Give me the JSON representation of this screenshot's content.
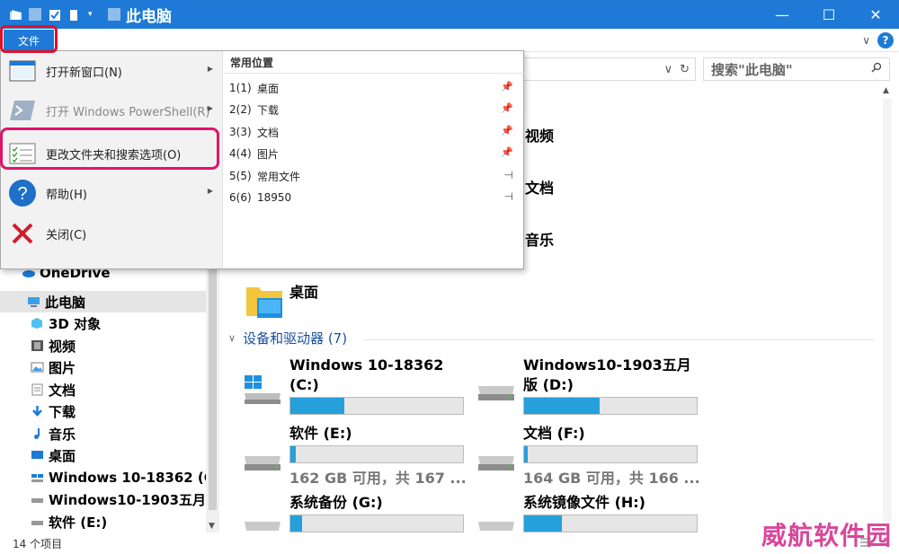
{
  "window": {
    "title": "此电脑",
    "minimize": "—",
    "maximize": "☐",
    "close": "✕"
  },
  "ribbon": {
    "file_tab": "文件",
    "collapse_arrow": "∨",
    "help": "?"
  },
  "address": {
    "dropdown_arrow": "∨",
    "refresh_glyph": "↻"
  },
  "search": {
    "placeholder": "搜索\"此电脑\"",
    "icon": "search-icon"
  },
  "file_menu": {
    "items": [
      {
        "label": "打开新窗口(N)",
        "icon": "new-window-icon",
        "has_submenu": true,
        "enabled": true
      },
      {
        "label": "打开 Windows PowerShell(R)",
        "icon": "powershell-icon",
        "has_submenu": true,
        "enabled": false
      },
      {
        "label": "更改文件夹和搜索选项(O)",
        "icon": "folder-options-icon",
        "has_submenu": false,
        "enabled": true
      },
      {
        "label": "帮助(H)",
        "icon": "help-icon",
        "has_submenu": true,
        "enabled": true
      },
      {
        "label": "关闭(C)",
        "icon": "close-x-icon",
        "has_submenu": false,
        "enabled": true
      }
    ],
    "recent_header": "常用位置",
    "recent": [
      {
        "index": "1(1)",
        "name": "桌面",
        "pinned": true
      },
      {
        "index": "2(2)",
        "name": "下载",
        "pinned": true
      },
      {
        "index": "3(3)",
        "name": "文档",
        "pinned": true
      },
      {
        "index": "4(4)",
        "name": "图片",
        "pinned": true
      },
      {
        "index": "5(5)",
        "name": "常用文件",
        "pinned": false
      },
      {
        "index": "6(6)",
        "name": "18950",
        "pinned": false
      }
    ]
  },
  "nav": {
    "items": [
      {
        "label": "OneDrive",
        "icon": "onedrive-icon"
      },
      {
        "label": "此电脑",
        "icon": "this-pc-icon",
        "selected": true
      },
      {
        "label": "3D 对象",
        "icon": "3d-objects-icon"
      },
      {
        "label": "视频",
        "icon": "videos-icon"
      },
      {
        "label": "图片",
        "icon": "pictures-icon"
      },
      {
        "label": "文档",
        "icon": "documents-icon"
      },
      {
        "label": "下载",
        "icon": "downloads-icon"
      },
      {
        "label": "音乐",
        "icon": "music-icon"
      },
      {
        "label": "桌面",
        "icon": "desktop-icon"
      },
      {
        "label": "Windows 10-18362 (C",
        "icon": "os-drive-icon"
      },
      {
        "label": "Windows10-1903五月",
        "icon": "drive-icon"
      },
      {
        "label": "软件 (E:)",
        "icon": "drive-icon"
      }
    ]
  },
  "folders": [
    {
      "label": "视频",
      "icon": "videos-folder-icon"
    },
    {
      "label": "文档",
      "icon": "documents-folder-icon"
    },
    {
      "label": "音乐",
      "icon": "music-folder-icon"
    },
    {
      "label": "桌面",
      "icon": "desktop-folder-icon"
    }
  ],
  "devices_header": "设备和驱动器 (7)",
  "drives": [
    {
      "name": "Windows 10-18362",
      "name2": "(C:)",
      "fill_fraction": 0.31,
      "free": "",
      "icon": "os-drive-icon"
    },
    {
      "name": "Windows10-1903五月",
      "name2": "版 (D:)",
      "fill_fraction": 0.44,
      "free": "",
      "icon": "drive-icon"
    },
    {
      "name": "软件 (E:)",
      "name2": "",
      "fill_fraction": 0.03,
      "free": "162 GB 可用，共 167 ...",
      "icon": "drive-icon"
    },
    {
      "name": "文档 (F:)",
      "name2": "",
      "fill_fraction": 0.02,
      "free": "164 GB 可用，共 166 ...",
      "icon": "drive-icon"
    },
    {
      "name": "系统备份 (G:)",
      "name2": "",
      "fill_fraction": 0.07,
      "free": "",
      "icon": "drive-icon"
    },
    {
      "name": "系统镜像文件 (H:)",
      "name2": "",
      "fill_fraction": 0.22,
      "free": "",
      "icon": "drive-icon"
    }
  ],
  "status": {
    "count": "14 个项目"
  },
  "watermark": "威航软件园",
  "colors": {
    "accent": "#1e7ad6",
    "highlight_outline": "#e0146a",
    "drive_bar": "#26a0da"
  }
}
